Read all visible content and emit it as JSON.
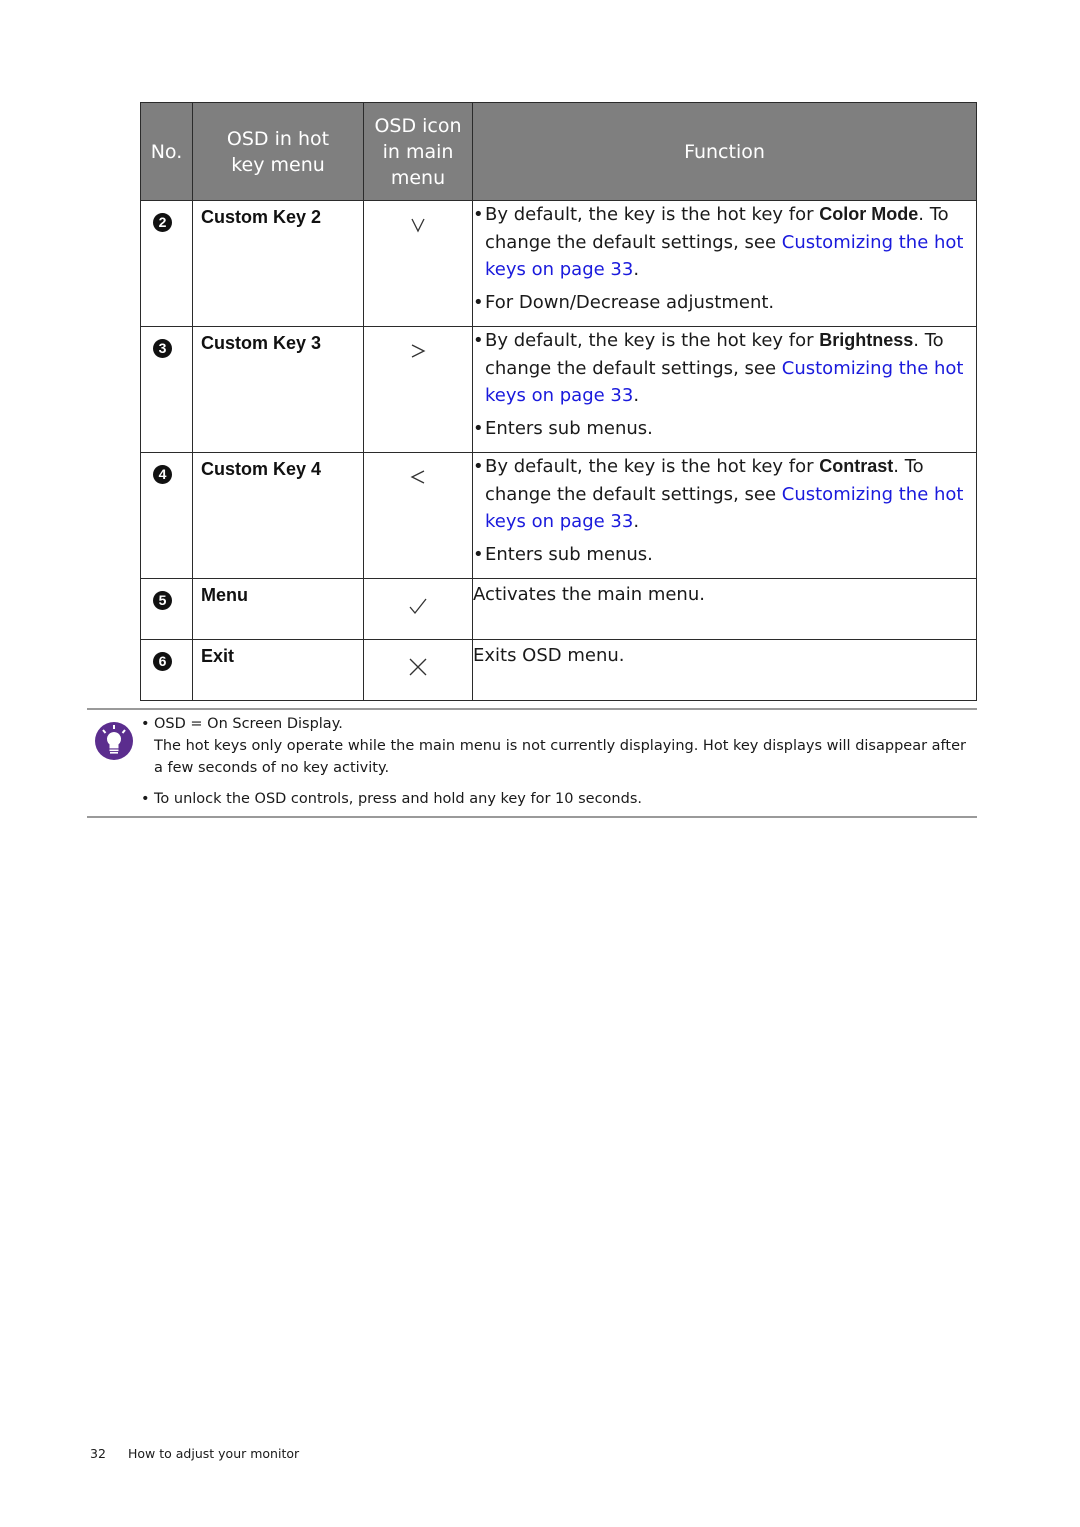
{
  "table": {
    "headers": {
      "no": "No.",
      "osd_hot_key": "OSD in hot key menu",
      "osd_icon": "OSD icon in main menu",
      "function": "Function"
    },
    "rows": [
      {
        "no": "2",
        "name": "Custom Key 2",
        "icon": "chevron-down-icon",
        "bullets": [
          {
            "pre": "By default, the key is the hot key for ",
            "bold": "Color Mode",
            "mid": ". To change the default settings, see ",
            "link": "Customizing the hot keys on page 33",
            "post": "."
          },
          {
            "text": "For Down/Decrease adjustment."
          }
        ]
      },
      {
        "no": "3",
        "name": "Custom Key 3",
        "icon": "chevron-right-icon",
        "bullets": [
          {
            "pre": "By default, the key is the hot key for ",
            "bold": "Brightness",
            "mid": ". To change the default settings, see ",
            "link": "Customizing the hot keys on page 33",
            "post": "."
          },
          {
            "text": "Enters sub menus."
          }
        ]
      },
      {
        "no": "4",
        "name": "Custom Key 4",
        "icon": "chevron-left-icon",
        "bullets": [
          {
            "pre": "By default, the key is the hot key for ",
            "bold": "Contrast",
            "mid": ". To change the default settings, see ",
            "link": "Customizing the hot keys on page 33",
            "post": "."
          },
          {
            "text": "Enters sub menus."
          }
        ]
      },
      {
        "no": "5",
        "name": "Menu",
        "icon": "checkmark-icon",
        "text": "Activates the main menu."
      },
      {
        "no": "6",
        "name": "Exit",
        "icon": "close-icon",
        "text": "Exits OSD menu."
      }
    ]
  },
  "note": {
    "icon": "lightbulb-icon",
    "accent_color": "#5b2d8e",
    "line1": "OSD = On Screen Display.",
    "line1_cont": "The hot keys only operate while the main menu is not currently displaying. Hot key displays will disappear after a few seconds of no key activity.",
    "line2": "To unlock the OSD controls, press and hold any key for 10 seconds."
  },
  "footer": {
    "page_number": "32",
    "section": "How to adjust your monitor"
  },
  "link_color": "#1a1adc",
  "header_bg": "#7f7f7f"
}
